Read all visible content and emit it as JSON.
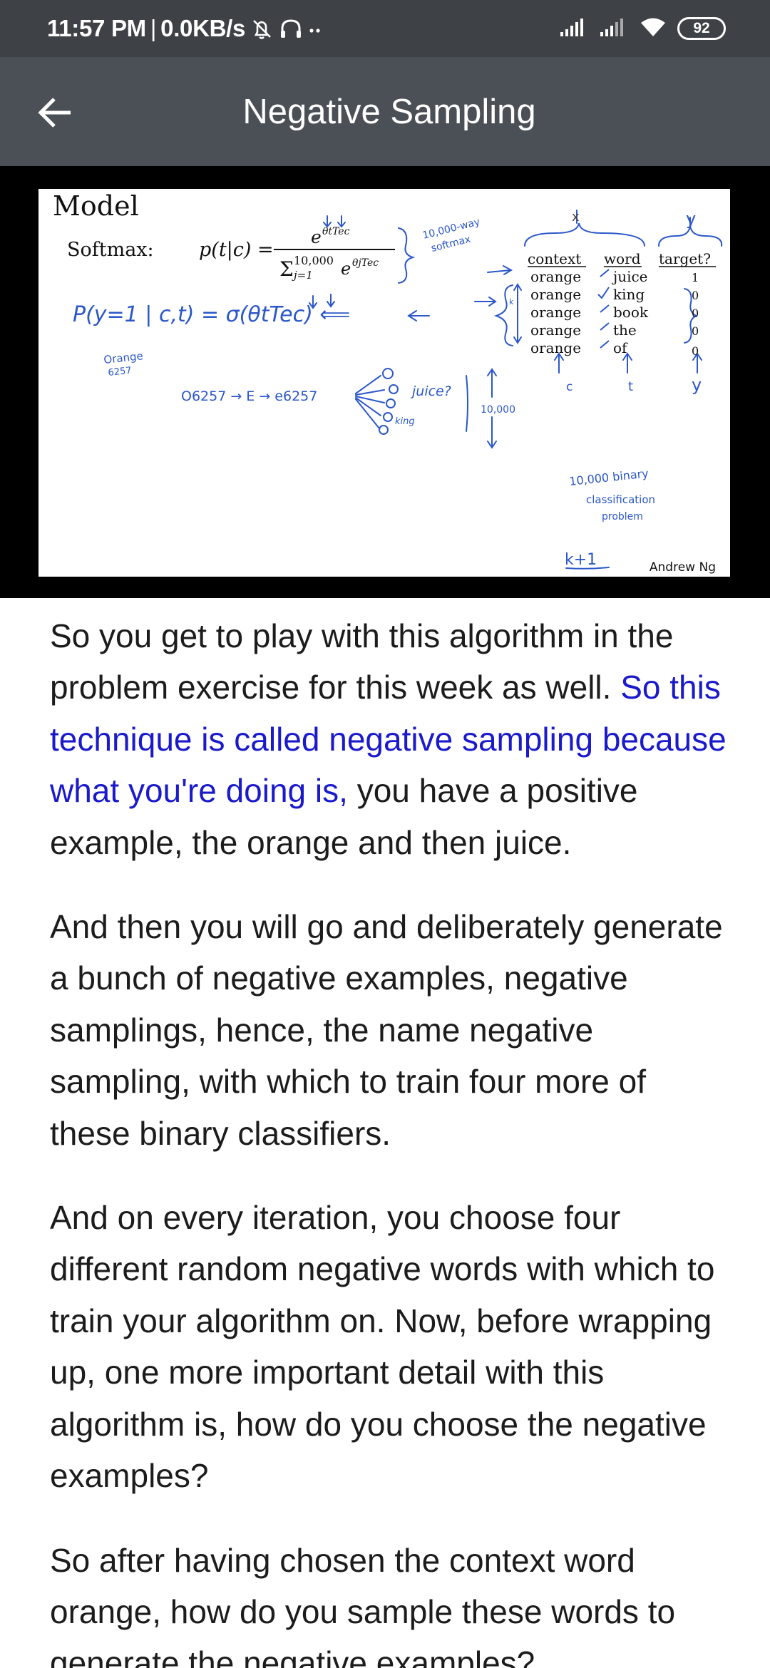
{
  "status_bar": {
    "time": "11:57 PM",
    "separator": "|",
    "network_speed": "0.0KB/s",
    "battery": "92",
    "icons": [
      "alarm-off-icon",
      "headphones-icon",
      "more-dots-icon",
      "signal-icon",
      "signal-icon",
      "wifi-icon",
      "battery-icon"
    ]
  },
  "app_bar": {
    "title": "Negative Sampling",
    "back_icon": "arrow-left-icon"
  },
  "slide": {
    "title": "Model",
    "softmax_label": "Softmax:",
    "formula_lhs": "p(t|c) =",
    "numerator": "e",
    "numerator_sup": "θtTec",
    "denominator": "Σ",
    "denominator_sup": "10,000",
    "denominator_sub": "j=1",
    "denominator_term": "e",
    "denominator_term_sup": "θjTec",
    "softmax_note_1": "10,000-way",
    "softmax_note_2": "softmax",
    "sigmoid_formula": "P(y=1 | c,t) = σ(θtTec) ⟸",
    "orange_label_1": "Orange",
    "orange_label_2": "6257",
    "pipeline": "O6257 → E → e6257",
    "juice_label": "juice?",
    "king_label": "king",
    "count_label": "10,000",
    "x_mark": "x",
    "y_mark": "y",
    "table": {
      "headers": [
        "context",
        "word",
        "target?"
      ],
      "rows": [
        [
          "orange",
          "juice",
          "1"
        ],
        [
          "orange",
          "king",
          "0"
        ],
        [
          "orange",
          "book",
          "0"
        ],
        [
          "orange",
          "the",
          "0"
        ],
        [
          "orange",
          "of",
          "0"
        ]
      ],
      "k_label": "k",
      "bottom_labels": [
        "c",
        "t",
        "y"
      ]
    },
    "binary_note_1": "10,000 binary",
    "binary_note_2": "classification",
    "binary_note_3": "problem",
    "k_plus_one": "k+1",
    "author": "Andrew Ng"
  },
  "transcript": {
    "p1_before": "So you get to play with this algorithm in the problem exercise for this week as well. ",
    "p1_highlight": "So this technique is called negative sampling because what you're doing is,",
    "p1_after": " you have a positive example, the orange and then juice.",
    "p2": "And then you will go and deliberately generate a bunch of negative examples, negative samplings, hence, the name negative sampling, with which to train four more of these binary classifiers.",
    "p3": "And on every iteration, you choose four different random negative words with which to train your algorithm on. Now, before wrapping up, one more important detail with this algorithm is, how do you choose the negative examples?",
    "p4": "So after having chosen the context word orange, how do you sample these words to generate the negative examples?"
  },
  "colors": {
    "status_bar_bg": "#3e4146",
    "app_bar_bg": "#4b5057",
    "highlight_text": "#1a1acc",
    "handwriting": "#2b57c8"
  }
}
